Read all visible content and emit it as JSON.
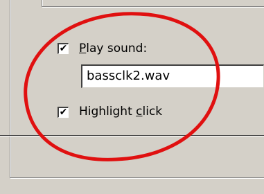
{
  "sound_options": {
    "play_sound": {
      "checked": true,
      "check_glyph": "✔",
      "label_accel": "P",
      "label_rest": "lay sound:"
    },
    "sound_file": {
      "value": "bassclk2.wav"
    },
    "highlight_click": {
      "checked": true,
      "check_glyph": "✔",
      "label_pre": "Highlight ",
      "label_accel": "c",
      "label_rest": "lick"
    }
  },
  "annotation": {
    "shape": "ellipse",
    "color": "#e01010"
  }
}
